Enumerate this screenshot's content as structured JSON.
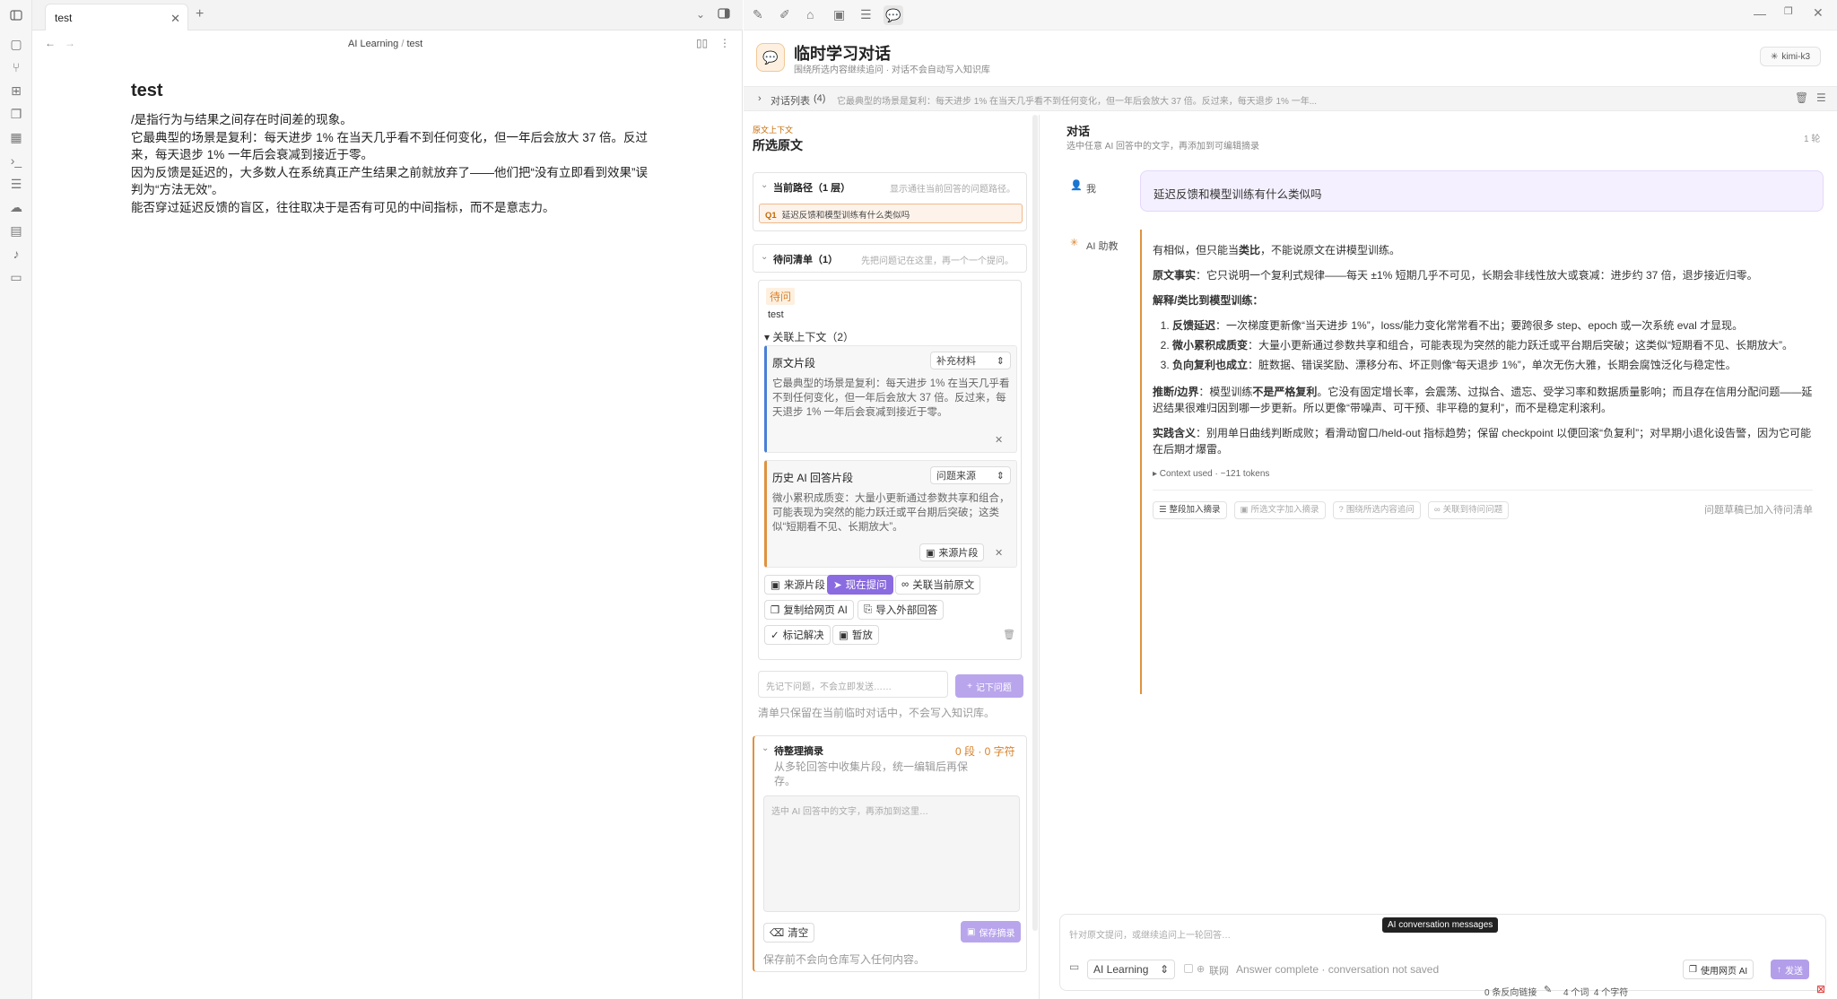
{
  "editor": {
    "tab_title": "test",
    "breadcrumb_parent": "AI Learning",
    "breadcrumb_sep": "/",
    "breadcrumb_current": "test",
    "note_title": "test",
    "note_lines": [
      "/是指行为与结果之间存在时间差的现象。",
      "它最典型的场景是复利：每天进步 1% 在当天几乎看不到任何变化，但一年后会放大 37 倍。反过",
      "来，每天退步 1% 一年后会衰减到接近于零。",
      "因为反馈是延迟的，大多数人在系统真正产生结果之前就放弃了——他们把“没有立即看到效果”误",
      "判为“方法无效”。",
      "能否穿过延迟反馈的盲区，往往取决于是否有可见的中间指标，而不是意志力。"
    ]
  },
  "panel": {
    "title": "临时学习对话",
    "subtitle": "围绕所选内容继续追问 · 对话不会自动写入知识库",
    "model": "kimi-k3",
    "conv_list_label": "对话列表",
    "conv_list_count": "(4)",
    "conv_list_preview": "它最典型的场景是复利：每天进步 1% 在当天几乎看不到任何变化，但一年后会放大 37 倍。反过来，每天退步 1% 一年..."
  },
  "context": {
    "tag": "原文上下文",
    "title": "所选原文",
    "path_title": "当前路径（1 层）",
    "path_hint": "显示通往当前回答的问题路径。",
    "q1_label": "Q1",
    "q1_text": "延迟反馈和模型训练有什么类似吗",
    "pending_title": "待问清单（1）",
    "pending_hint": "先把问题记在这里，再一个一个提问。",
    "pending_badge": "待问",
    "pending_text": "test",
    "related_ctx": "▾ 关联上下文（2）",
    "card1_title": "原文片段",
    "card1_select": "补充材料",
    "card1_body": "它最典型的场景是复利：每天进步 1% 在当天几乎看不到任何变化，但一年后会放大 37 倍。反过来，每天退步 1% 一年后会衰减到接近于零。",
    "card2_title": "历史 AI 回答片段",
    "card2_select": "问题来源",
    "card2_body": "微小累积成质变：大量小更新通过参数共享和组合，可能表现为突然的能力跃迁或平台期后突破；这类似“短期看不见、长期放大”。",
    "card2_source": "来源片段",
    "btn_source": "来源片段",
    "btn_ask_now": "现在提问",
    "btn_link_original": "关联当前原文",
    "btn_copy_web": "复制给网页 AI",
    "btn_import": "导入外部回答",
    "btn_mark_solved": "标记解决",
    "btn_pause": "暂放",
    "next_q_placeholder": "先记下问题，不会立即发送……",
    "btn_record_next": "记下问题",
    "list_note": "清单只保留在当前临时对话中，不会写入知识库。",
    "digest_title": "待整理摘录",
    "digest_count": "0 段 · 0 字符",
    "digest_hint": "从多轮回答中收集片段，统一编辑后再保存。",
    "digest_placeholder": "选中 AI 回答中的文字，再添加到这里…",
    "btn_clear": "清空",
    "btn_save_digest": "保存摘录",
    "digest_note": "保存前不会向仓库写入任何内容。"
  },
  "conversation": {
    "title": "对话",
    "subtitle": "选中任意 AI 回答中的文字，再添加到可编辑摘录",
    "turns": "1 轮",
    "user_label": "我",
    "user_msg": "延迟反馈和模型训练有什么类似吗",
    "ai_label": "AI 助教",
    "ai_p1_a": "有相似，但只能当",
    "ai_p1_b": "类比",
    "ai_p1_c": "，不能说原文在讲模型训练。",
    "ai_p2_a": "原文事实",
    "ai_p2_b": "：它只说明一个复利式规律——每天 ±1% 短期几乎不可见，长期会非线性放大或衰减：进步约 37 倍，退步接近归零。",
    "ai_p3": "解释/类比到模型训练：",
    "li1_a": "反馈延迟",
    "li1_b": "：一次梯度更新像“当天进步 1%”，loss/能力变化常常看不出；要跨很多 step、epoch 或一次系统 eval 才显现。",
    "li2_a": "微小累积成质变",
    "li2_b": "：大量小更新通过参数共享和组合，可能表现为突然的能力跃迁或平台期后突破；这类似“短期看不见、长期放大”。",
    "li3_a": "负向复利也成立",
    "li3_b": "：脏数据、错误奖励、漂移分布、坏正则像“每天退步 1%”，单次无伤大雅，长期会腐蚀泛化与稳定性。",
    "ai_p4_a": "推断/边界",
    "ai_p4_b": "：模型训练",
    "ai_p4_c": "不是严格复利",
    "ai_p4_d": "。它没有固定增长率，会震荡、过拟合、遗忘、受学习率和数据质量影响；而且存在信用分配问题——延迟结果很难归因到哪一步更新。所以更像“带噪声、可干预、非平稳的复利”，而不是稳定利滚利。",
    "ai_p5_a": "实践含义",
    "ai_p5_b": "：别用单日曲线判断成败；看滑动窗口/held-out 指标趋势；保留 checkpoint 以便回滚“负复利”；对早期小退化设告警，因为它可能在后期才爆雷。",
    "context_used": "▸ Context used · ~121 tokens",
    "act_whole": "整段加入摘录",
    "act_selected": "所选文字加入摘录",
    "act_follow": "围绕所选内容追问",
    "act_link": "关联到待问问题",
    "draft_note": "问题草稿已加入待问清单",
    "composer_placeholder": "针对原文提问，或继续追问上一轮回答…",
    "tooltip": "AI conversation messages",
    "vault_select": "AI Learning",
    "web_label": "联网",
    "status": "Answer complete · conversation not saved",
    "btn_use_web": "使用网页 AI",
    "btn_send": "发送"
  },
  "statusbar": {
    "backlinks": "0 条反向链接",
    "counts": "4 个词  4 个字符"
  },
  "colors": {
    "accent": "#8b6be0",
    "orange": "#e0913f",
    "blue": "#4a7fd6"
  }
}
